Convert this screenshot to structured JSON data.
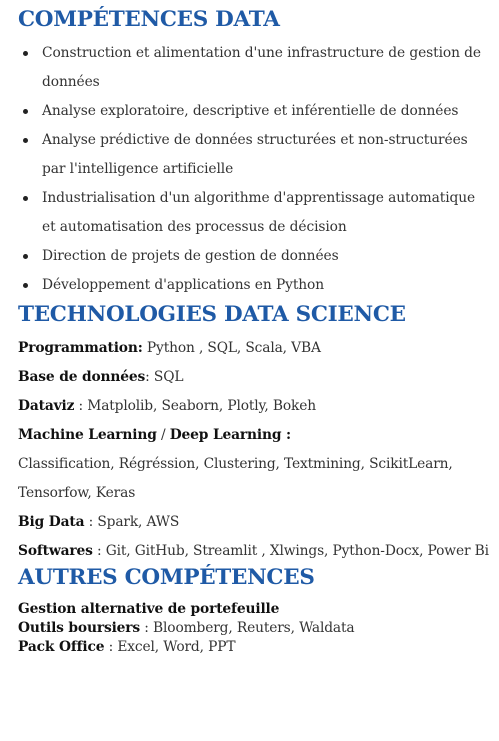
{
  "sections": {
    "competences": {
      "title": "COMPÉTENCES DATA",
      "items": [
        "Construction et alimentation d'une infrastructure de gestion de données",
        "Analyse exploratoire, descriptive et inférentielle de données",
        "Analyse prédictive de données structurées et non-structurées  par l'intelligence artificielle",
        "Industrialisation d'un algorithme d'apprentissage automatique et automatisation des processus de décision",
        "Direction de projets de gestion de données",
        "Développement d'applications en Python"
      ]
    },
    "technologies": {
      "title": "TECHNOLOGIES DATA SCIENCE",
      "programmation": {
        "label": "Programmation:",
        "value": " Python , SQL, Scala, VBA"
      },
      "bdd": {
        "label": "Base de données",
        "value": ": SQL"
      },
      "dataviz": {
        "label": "Dataviz",
        "value": " : Matplolib, Seaborn, Plotly, Bokeh"
      },
      "ml": {
        "label_ml": "Machine Learning",
        "separator": " / ",
        "label_dl": "Deep Learning :",
        "value": "Classification, Régréssion, Clustering, Textmining, ScikitLearn, Tensorfow, Keras"
      },
      "bigdata": {
        "label": "Big Data",
        "value": " : Spark, AWS"
      },
      "softwares": {
        "label": "Softwares",
        "value": " : Git, GitHub, Streamlit , Xlwings, Python-Docx, Power Bi"
      }
    },
    "autres": {
      "title": "AUTRES COMPÉTENCES",
      "gestion": {
        "label": "Gestion alternative de portefeuille"
      },
      "outils": {
        "label": "Outils boursiers",
        "value": " : Bloomberg, Reuters, Waldata"
      },
      "pack": {
        "label": "Pack Office",
        "value": " : Excel, Word, PPT"
      }
    }
  },
  "colors": {
    "heading": "#1f5aa6",
    "text": "#333333"
  }
}
